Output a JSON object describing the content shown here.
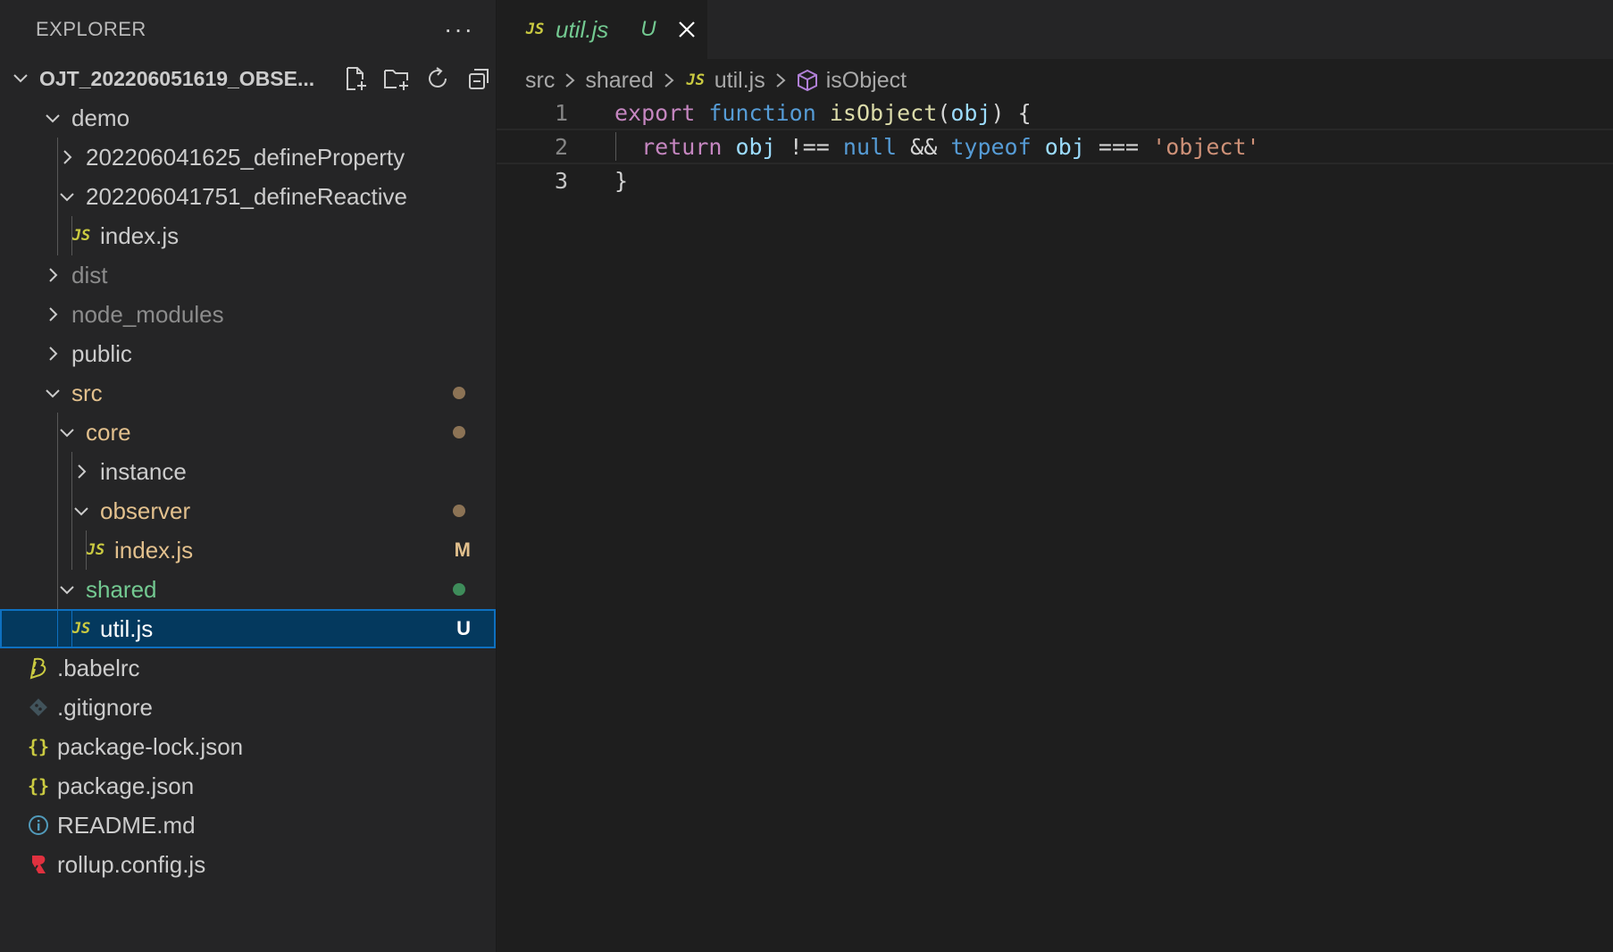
{
  "sidebar": {
    "title": "EXPLORER",
    "more": "···",
    "root": {
      "label": "OJT_202206051619_OBSE..."
    },
    "items": [
      {
        "label": "demo",
        "kind": "folder",
        "open": true,
        "depth": 1,
        "color": "#cccccc"
      },
      {
        "label": "202206041625_defineProperty",
        "kind": "folder",
        "open": false,
        "depth": 2,
        "color": "#cccccc"
      },
      {
        "label": "202206041751_defineReactive",
        "kind": "folder",
        "open": true,
        "depth": 2,
        "color": "#cccccc"
      },
      {
        "label": "index.js",
        "kind": "js",
        "depth": 3,
        "color": "#cccccc"
      },
      {
        "label": "dist",
        "kind": "folder",
        "open": false,
        "depth": 1,
        "color": "#8c8c8c"
      },
      {
        "label": "node_modules",
        "kind": "folder",
        "open": false,
        "depth": 1,
        "color": "#8c8c8c"
      },
      {
        "label": "public",
        "kind": "folder",
        "open": false,
        "depth": 1,
        "color": "#cccccc"
      },
      {
        "label": "src",
        "kind": "folder",
        "open": true,
        "depth": 1,
        "color": "#e2c08d",
        "dot": "#8c7355"
      },
      {
        "label": "core",
        "kind": "folder",
        "open": true,
        "depth": 2,
        "color": "#e2c08d",
        "dot": "#8c7355"
      },
      {
        "label": "instance",
        "kind": "folder",
        "open": false,
        "depth": 3,
        "color": "#cccccc"
      },
      {
        "label": "observer",
        "kind": "folder",
        "open": true,
        "depth": 3,
        "color": "#e2c08d",
        "dot": "#8c7355"
      },
      {
        "label": "index.js",
        "kind": "js",
        "depth": 4,
        "color": "#e2c08d",
        "badge": "M",
        "badge_color": "#e2c08d"
      },
      {
        "label": "shared",
        "kind": "folder",
        "open": true,
        "depth": 2,
        "color": "#73c991",
        "dot": "#3e8c5a"
      },
      {
        "label": "util.js",
        "kind": "js",
        "depth": 3,
        "color": "#ffffff",
        "badge": "U",
        "badge_color": "#73c991",
        "selected": true
      },
      {
        "label": ".babelrc",
        "kind": "babel",
        "depth": 1,
        "color": "#cccccc"
      },
      {
        "label": ".gitignore",
        "kind": "git",
        "depth": 1,
        "color": "#cccccc"
      },
      {
        "label": "package-lock.json",
        "kind": "json",
        "depth": 1,
        "color": "#cccccc"
      },
      {
        "label": "package.json",
        "kind": "json",
        "depth": 1,
        "color": "#cccccc"
      },
      {
        "label": "README.md",
        "kind": "info",
        "depth": 1,
        "color": "#cccccc"
      },
      {
        "label": "rollup.config.js",
        "kind": "rollup",
        "depth": 1,
        "color": "#cccccc"
      }
    ]
  },
  "tab": {
    "icon_text": "JS",
    "name": "util.js",
    "status": "U"
  },
  "breadcrumb": {
    "parts": [
      "src",
      "shared",
      "util.js",
      "isObject"
    ],
    "file_icon_text": "JS"
  },
  "editor": {
    "lines": [
      {
        "number": "1"
      },
      {
        "number": "2"
      },
      {
        "number": "3"
      }
    ],
    "tokens": {
      "l1": [
        "export",
        " ",
        "function",
        " ",
        "isObject",
        "(",
        "obj",
        ") {"
      ],
      "l2": [
        "  ",
        "return",
        " ",
        "obj",
        " !== ",
        "null",
        " && ",
        "typeof",
        " ",
        "obj",
        " === ",
        "'object'"
      ],
      "l3": [
        "}"
      ]
    }
  },
  "colors": {
    "sidebar_bg": "#252526",
    "editor_bg": "#1e1e1e",
    "selection": "#04395e",
    "accent": "#0e70c0"
  }
}
